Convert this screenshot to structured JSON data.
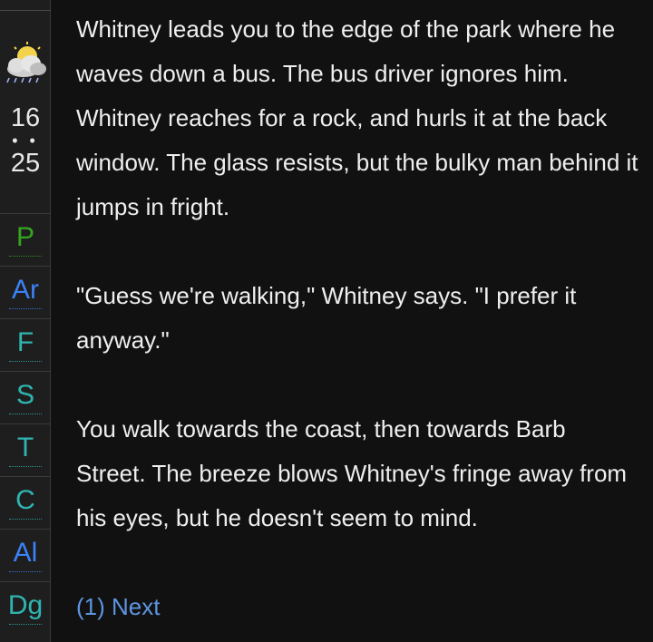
{
  "sidebar": {
    "weather_icon": "partly-cloudy-rain-icon",
    "clock": {
      "hour": "16",
      "separator": "• •",
      "minute": "25"
    },
    "stats": [
      {
        "label": "P",
        "color": "#35a520"
      },
      {
        "label": "Ar",
        "color": "#3b82f6"
      },
      {
        "label": "F",
        "color": "#2fb5b0"
      },
      {
        "label": "S",
        "color": "#2fb5b0"
      },
      {
        "label": "T",
        "color": "#2fb5b0"
      },
      {
        "label": "C",
        "color": "#2fb5b0"
      },
      {
        "label": "Al",
        "color": "#3b82f6"
      },
      {
        "label": "Dg",
        "color": "#2fb5b0"
      }
    ]
  },
  "story": {
    "paragraphs": [
      "Whitney leads you to the edge of the park where he waves down a bus. The bus driver ignores him. Whitney reaches for a rock, and hurls it at the back window. The glass resists, but the bulky man behind it jumps in fright.",
      "\"Guess we're walking,\" Whitney says. \"I prefer it anyway.\"",
      "You walk towards the coast, then towards Barb Street. The breeze blows Whitney's fringe away from his eyes, but he doesn't seem to mind."
    ],
    "next_link": "(1) Next"
  },
  "colors": {
    "background": "#111111",
    "sidebar": "#1e1e1e",
    "text": "#efefef",
    "link": "#5e95e2"
  }
}
